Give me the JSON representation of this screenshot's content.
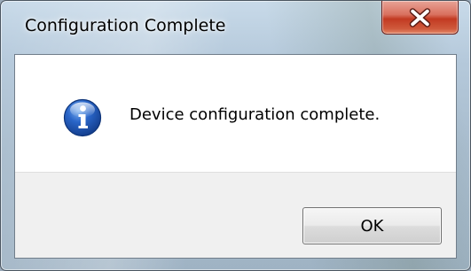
{
  "window": {
    "title": "Configuration Complete"
  },
  "title_bar": {
    "close_icon": "close-x-icon"
  },
  "dialog": {
    "icon": "information-icon",
    "message": "Device configuration complete."
  },
  "buttons": {
    "ok_label": "OK"
  },
  "colors": {
    "close_button": "#c23a22",
    "info_icon": "#1f56b5",
    "button_bar": "#f0f0f0"
  }
}
